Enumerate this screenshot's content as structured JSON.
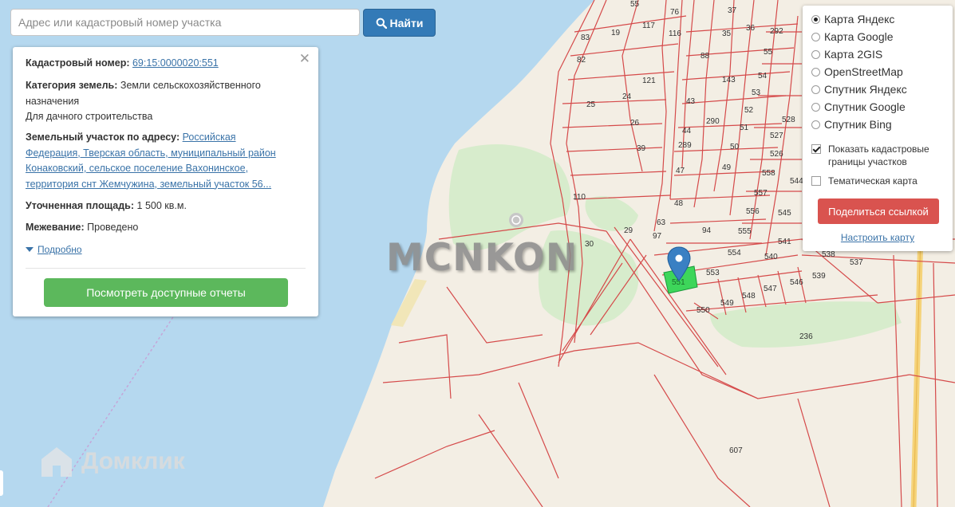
{
  "search": {
    "placeholder": "Адрес или кадастровый номер участка",
    "button_label": "Найти"
  },
  "info": {
    "cadastral_label": "Кадастровый номер:",
    "cadastral_number": "69:15:0000020:551",
    "category_label": "Категория земель:",
    "category_value_1": "Земли сельскохозяйственного",
    "category_value_2": "назначения",
    "category_value_3": "Для дачного строительства",
    "address_label": "Земельный участок по адресу:",
    "address_1": "Российская",
    "address_2": "Федерация, Тверская область, муниципальный район",
    "address_3": "Конаковский, сельское поселение Вахонинское,",
    "address_4": "территория снт Жемчужина, земельный участок 56...",
    "area_label": "Уточненная площадь:",
    "area_value": "1 500 кв.м.",
    "survey_label": "Межевание:",
    "survey_value": "Проведено",
    "details_label": "Подробно",
    "reports_button": "Посмотреть доступные отчеты"
  },
  "layers": {
    "map_options": [
      "Карта Яндекс",
      "Карта Google",
      "Карта 2GIS",
      "OpenStreetMap",
      "Спутник Яндекс",
      "Спутник Google",
      "Спутник Bing"
    ],
    "selected_map": "Карта Яндекс",
    "show_borders_1": "Показать кадастровые",
    "show_borders_2": "границы участков",
    "show_borders_checked": true,
    "thematic": "Тематическая карта",
    "thematic_checked": false,
    "share_button": "Поделиться ссылкой",
    "settings_link": "Настроить карту"
  },
  "map": {
    "parcel_numbers": [
      "55",
      "76",
      "37",
      "292",
      "19",
      "117",
      "116",
      "35",
      "36",
      "83",
      "88",
      "82",
      "54",
      "55",
      "121",
      "143",
      "25",
      "24",
      "43",
      "53",
      "290",
      "52",
      "528",
      "26",
      "44",
      "51",
      "527",
      "39",
      "289",
      "50",
      "526",
      "49",
      "558",
      "47",
      "544",
      "110",
      "48",
      "557",
      "545",
      "556",
      "94",
      "555",
      "541",
      "63",
      "29",
      "97",
      "554",
      "540",
      "30",
      "538",
      "537",
      "553",
      "539",
      "547",
      "546",
      "548",
      "549",
      "550",
      "236",
      "607"
    ],
    "highlighted_parcel": "551",
    "watermark": "MCNKON",
    "brand": "Домклик",
    "colors": {
      "water": "#b5d8ef",
      "land": "#f3eee4",
      "green": "#d7eccc",
      "parcel_border": "#d54a4a",
      "selected_parcel": "#3dd65a",
      "marker": "#3a80c3"
    }
  }
}
